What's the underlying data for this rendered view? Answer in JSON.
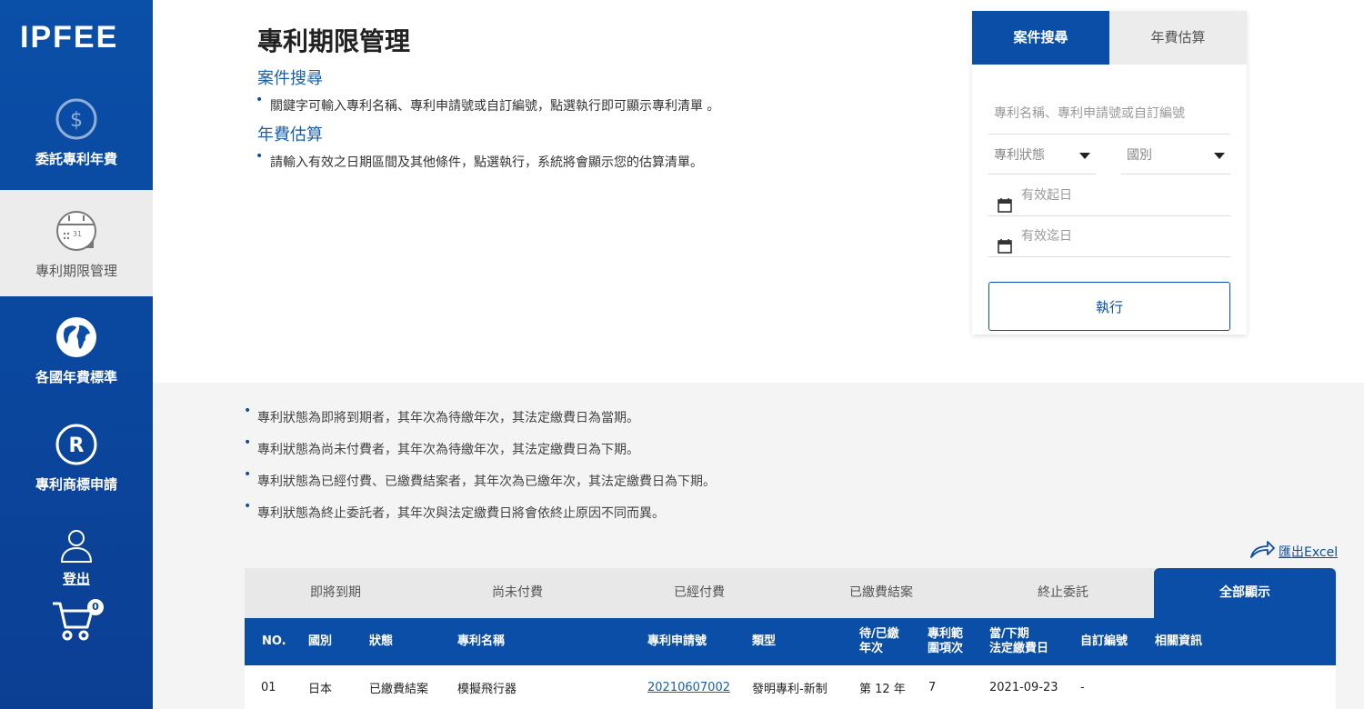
{
  "sidebar": {
    "logo": "IPFEE",
    "items": [
      {
        "label": "委託專利年費",
        "icon": "dollar-icon"
      },
      {
        "label": "專利期限管理",
        "icon": "calendar-icon"
      },
      {
        "label": "各國年費標準",
        "icon": "globe-icon"
      },
      {
        "label": "專利商標申請",
        "icon": "registered-icon"
      },
      {
        "label": "登出",
        "icon": "user-icon"
      }
    ],
    "cart_count": "0"
  },
  "page": {
    "title": "專利期限管理",
    "sections": [
      {
        "heading": "案件搜尋",
        "bullet": "關鍵字可輸入專利名稱、專利申請號或自訂編號，點選執行即可顯示專利清單 。"
      },
      {
        "heading": "年費估算",
        "bullet": "請輸入有效之日期區間及其他條件，點選執行，系統將會顯示您的估算清單。"
      }
    ]
  },
  "panel": {
    "tabs": [
      "案件搜尋",
      "年費估算"
    ],
    "keyword_placeholder": "專利名稱、專利申請號或自訂編號",
    "status_select": "專利狀態",
    "country_select": "國別",
    "start_date_placeholder": "有效起日",
    "end_date_placeholder": "有效迄日",
    "execute_label": "執行"
  },
  "notes": [
    "專利狀態為即將到期者，其年次為待繳年次，其法定繳費日為當期。",
    "專利狀態為尚未付費者，其年次為待繳年次，其法定繳費日為下期。",
    "專利狀態為已經付費、已繳費結案者，其年次為已繳年次，其法定繳費日為下期。",
    "專利狀態為終止委託者，其年次與法定繳費日將會依終止原因不同而異。"
  ],
  "export_label": "匯出Excel",
  "status_tabs": [
    "即將到期",
    "尚未付費",
    "已經付費",
    "已繳費結案",
    "終止委託",
    "全部顯示"
  ],
  "table": {
    "headers": [
      "NO.",
      "國別",
      "狀態",
      "專利名稱",
      "專利申請號",
      "類型",
      "待/已繳\n年次",
      "專利範\n圍項次",
      "當/下期\n法定繳費日",
      "自訂編號",
      "相關資訊"
    ],
    "rows": [
      [
        "01",
        "日本",
        "已繳費結案",
        "模擬飛行器",
        "20210607002",
        "發明專利-新制",
        "第 12 年",
        "7",
        "2021-09-23",
        "-",
        ""
      ]
    ]
  },
  "colors": {
    "primary": "#0b4ea8",
    "panel_tab_inactive": "#ececec",
    "lower_bg": "#f4f4f4"
  }
}
